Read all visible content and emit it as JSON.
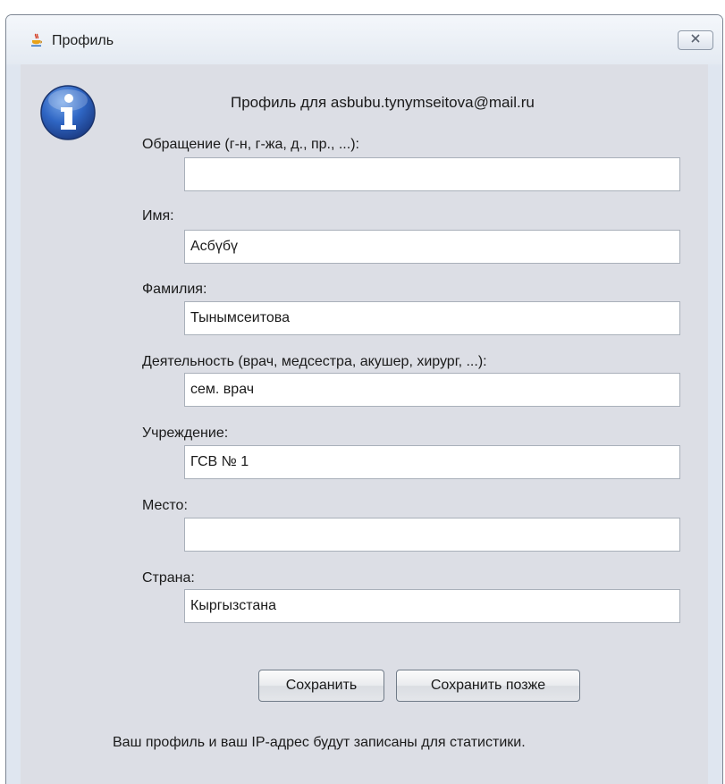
{
  "window": {
    "title": "Профиль"
  },
  "header": {
    "profile_heading": "Профиль для asbubu.tynymseitova@mail.ru"
  },
  "fields": [
    {
      "label": "Обращение (г-н, г-жа, д., пр., ...):",
      "value": ""
    },
    {
      "label": "Имя:",
      "value": "Асбүбү"
    },
    {
      "label": "Фамилия:",
      "value": "Тынымсеитова"
    },
    {
      "label": "Деятельность (врач, медсестра, акушер, хирург, ...):",
      "value": "сем. врач"
    },
    {
      "label": "Учреждение:",
      "value": "ГСВ № 1"
    },
    {
      "label": "Место:",
      "value": ""
    },
    {
      "label": "Страна:",
      "value": "Кыргызстана"
    }
  ],
  "buttons": {
    "save_label": "Сохранить",
    "save_later_label": "Сохранить позже"
  },
  "footer": {
    "notice": "Ваш профиль и ваш IP-адрес будут записаны для статистики."
  },
  "icons": {
    "app_icon": "java-cup-icon",
    "info_icon": "info-icon",
    "close_icon": "close-icon"
  }
}
